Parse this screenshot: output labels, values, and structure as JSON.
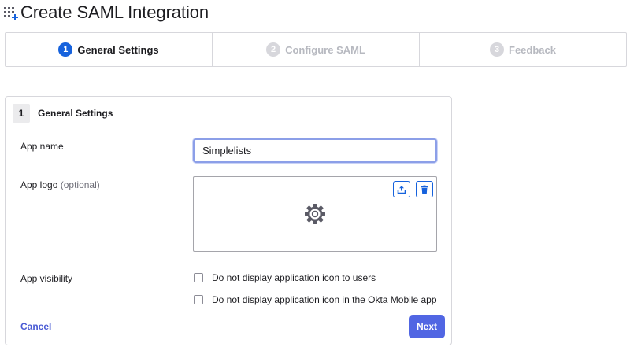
{
  "page": {
    "title": "Create SAML Integration",
    "title_icon": "grid-plus-icon"
  },
  "stepper": {
    "steps": [
      {
        "number": "1",
        "label": "General Settings",
        "state": "active"
      },
      {
        "number": "2",
        "label": "Configure SAML",
        "state": "inactive"
      },
      {
        "number": "3",
        "label": "Feedback",
        "state": "inactive"
      }
    ]
  },
  "card": {
    "step_number": "1",
    "title": "General Settings",
    "app_name": {
      "label": "App name",
      "value": "Simplelists"
    },
    "app_logo": {
      "label": "App logo",
      "optional": "(optional)",
      "placeholder_icon": "gear-icon",
      "upload_icon": "upload-icon",
      "delete_icon": "trash-icon"
    },
    "app_visibility": {
      "label": "App visibility",
      "options": [
        {
          "label": "Do not display application icon to users",
          "checked": false
        },
        {
          "label": "Do not display application icon in the Okta Mobile app",
          "checked": false
        }
      ]
    },
    "cancel_label": "Cancel",
    "next_label": "Next"
  },
  "colors": {
    "accent": "#1662dd",
    "button": "#5166e3",
    "link": "#4a5bd4",
    "border": "#d7d7dc"
  }
}
